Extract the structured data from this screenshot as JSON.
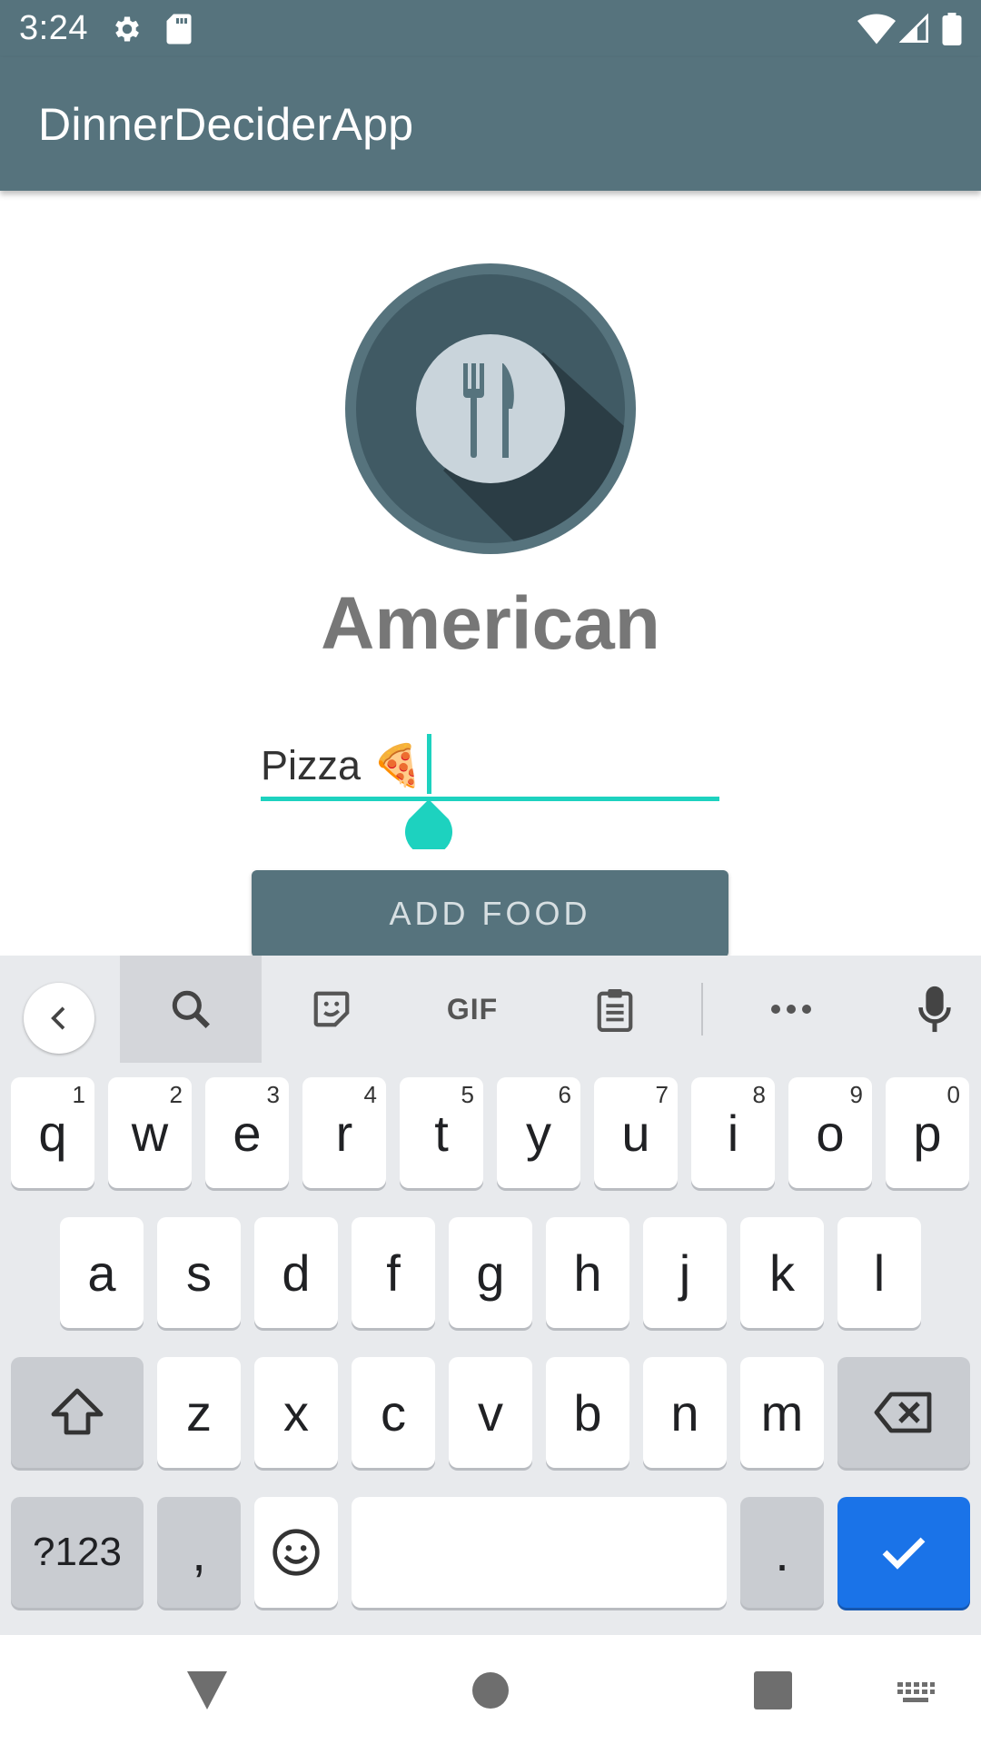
{
  "status_bar": {
    "time": "3:24",
    "icons": [
      "settings-icon",
      "sd-card-icon",
      "wifi-icon",
      "signal-icon",
      "battery-icon"
    ]
  },
  "app": {
    "title": "DinnerDeciderApp"
  },
  "logo": {
    "icon": "fork-knife-icon"
  },
  "cuisine": "American",
  "food_input": {
    "value": "Pizza 🍕"
  },
  "add_button": {
    "label": "ADD FOOD"
  },
  "keyboard": {
    "toolbar": [
      "back-icon",
      "search-icon",
      "sticker-icon",
      "GIF",
      "clipboard-icon",
      "more-icon",
      "mic-icon"
    ],
    "gif_label": "GIF",
    "row1": [
      {
        "k": "q",
        "h": "1"
      },
      {
        "k": "w",
        "h": "2"
      },
      {
        "k": "e",
        "h": "3"
      },
      {
        "k": "r",
        "h": "4"
      },
      {
        "k": "t",
        "h": "5"
      },
      {
        "k": "y",
        "h": "6"
      },
      {
        "k": "u",
        "h": "7"
      },
      {
        "k": "i",
        "h": "8"
      },
      {
        "k": "o",
        "h": "9"
      },
      {
        "k": "p",
        "h": "0"
      }
    ],
    "row2": [
      "a",
      "s",
      "d",
      "f",
      "g",
      "h",
      "j",
      "k",
      "l"
    ],
    "row3": [
      "z",
      "x",
      "c",
      "v",
      "b",
      "n",
      "m"
    ],
    "symbols_label": "?123",
    "comma": ",",
    "period": "."
  },
  "colors": {
    "primary": "#56737d",
    "accent": "#1dd2bf",
    "done_key": "#1a73e8"
  }
}
